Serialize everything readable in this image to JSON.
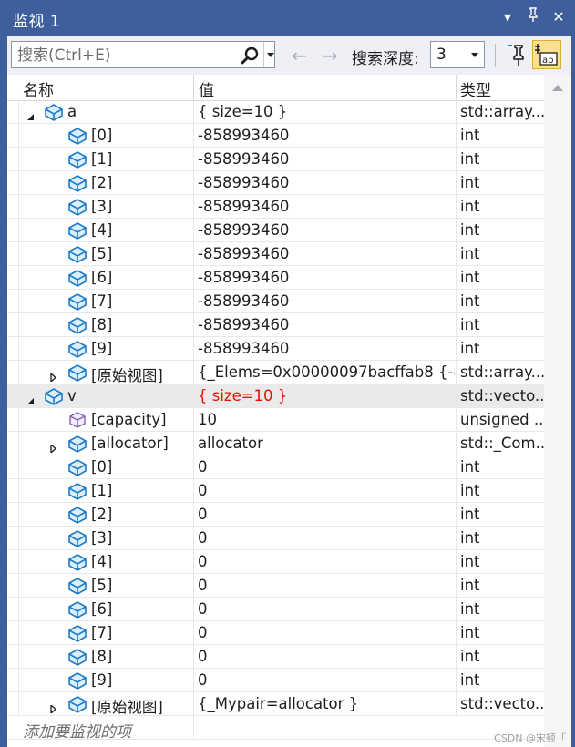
{
  "window": {
    "title": "监视 1"
  },
  "toolbar": {
    "search_placeholder": "搜索(Ctrl+E)",
    "depth_label": "搜索深度:",
    "depth_value": "3",
    "accent": "#3e5f9b"
  },
  "columns": {
    "name": "名称",
    "value": "值",
    "type": "类型"
  },
  "rows": [
    {
      "indent": 0,
      "expander": "expanded",
      "icon": "blue-cube-icon",
      "name": "a",
      "value": "{ size=10 }",
      "type": "std::array...",
      "changed": false,
      "selected": false
    },
    {
      "indent": 1,
      "expander": "none",
      "icon": "blue-cube-icon",
      "name": "[0]",
      "value": "-858993460",
      "type": "int",
      "changed": false,
      "selected": false
    },
    {
      "indent": 1,
      "expander": "none",
      "icon": "blue-cube-icon",
      "name": "[1]",
      "value": "-858993460",
      "type": "int",
      "changed": false,
      "selected": false
    },
    {
      "indent": 1,
      "expander": "none",
      "icon": "blue-cube-icon",
      "name": "[2]",
      "value": "-858993460",
      "type": "int",
      "changed": false,
      "selected": false
    },
    {
      "indent": 1,
      "expander": "none",
      "icon": "blue-cube-icon",
      "name": "[3]",
      "value": "-858993460",
      "type": "int",
      "changed": false,
      "selected": false
    },
    {
      "indent": 1,
      "expander": "none",
      "icon": "blue-cube-icon",
      "name": "[4]",
      "value": "-858993460",
      "type": "int",
      "changed": false,
      "selected": false
    },
    {
      "indent": 1,
      "expander": "none",
      "icon": "blue-cube-icon",
      "name": "[5]",
      "value": "-858993460",
      "type": "int",
      "changed": false,
      "selected": false
    },
    {
      "indent": 1,
      "expander": "none",
      "icon": "blue-cube-icon",
      "name": "[6]",
      "value": "-858993460",
      "type": "int",
      "changed": false,
      "selected": false
    },
    {
      "indent": 1,
      "expander": "none",
      "icon": "blue-cube-icon",
      "name": "[7]",
      "value": "-858993460",
      "type": "int",
      "changed": false,
      "selected": false
    },
    {
      "indent": 1,
      "expander": "none",
      "icon": "blue-cube-icon",
      "name": "[8]",
      "value": "-858993460",
      "type": "int",
      "changed": false,
      "selected": false
    },
    {
      "indent": 1,
      "expander": "none",
      "icon": "blue-cube-icon",
      "name": "[9]",
      "value": "-858993460",
      "type": "int",
      "changed": false,
      "selected": false
    },
    {
      "indent": 1,
      "expander": "collapsed",
      "icon": "blue-cube-icon",
      "name": "[原始视图]",
      "value": "{_Elems=0x00000097bacffab8 {-8...",
      "type": "std::array...",
      "changed": false,
      "selected": false
    },
    {
      "indent": 0,
      "expander": "expanded",
      "icon": "blue-cube-icon",
      "name": "v",
      "value": "{ size=10 }",
      "type": "std::vecto...",
      "changed": true,
      "selected": true
    },
    {
      "indent": 1,
      "expander": "none",
      "icon": "purple-cube-icon",
      "name": "[capacity]",
      "value": "10",
      "type": "unsigned ...",
      "changed": false,
      "selected": false
    },
    {
      "indent": 1,
      "expander": "collapsed",
      "icon": "blue-cube-icon",
      "name": "[allocator]",
      "value": "allocator",
      "type": "std::_Com...",
      "changed": false,
      "selected": false
    },
    {
      "indent": 1,
      "expander": "none",
      "icon": "blue-cube-icon",
      "name": "[0]",
      "value": "0",
      "type": "int",
      "changed": false,
      "selected": false
    },
    {
      "indent": 1,
      "expander": "none",
      "icon": "blue-cube-icon",
      "name": "[1]",
      "value": "0",
      "type": "int",
      "changed": false,
      "selected": false
    },
    {
      "indent": 1,
      "expander": "none",
      "icon": "blue-cube-icon",
      "name": "[2]",
      "value": "0",
      "type": "int",
      "changed": false,
      "selected": false
    },
    {
      "indent": 1,
      "expander": "none",
      "icon": "blue-cube-icon",
      "name": "[3]",
      "value": "0",
      "type": "int",
      "changed": false,
      "selected": false
    },
    {
      "indent": 1,
      "expander": "none",
      "icon": "blue-cube-icon",
      "name": "[4]",
      "value": "0",
      "type": "int",
      "changed": false,
      "selected": false
    },
    {
      "indent": 1,
      "expander": "none",
      "icon": "blue-cube-icon",
      "name": "[5]",
      "value": "0",
      "type": "int",
      "changed": false,
      "selected": false
    },
    {
      "indent": 1,
      "expander": "none",
      "icon": "blue-cube-icon",
      "name": "[6]",
      "value": "0",
      "type": "int",
      "changed": false,
      "selected": false
    },
    {
      "indent": 1,
      "expander": "none",
      "icon": "blue-cube-icon",
      "name": "[7]",
      "value": "0",
      "type": "int",
      "changed": false,
      "selected": false
    },
    {
      "indent": 1,
      "expander": "none",
      "icon": "blue-cube-icon",
      "name": "[8]",
      "value": "0",
      "type": "int",
      "changed": false,
      "selected": false
    },
    {
      "indent": 1,
      "expander": "none",
      "icon": "blue-cube-icon",
      "name": "[9]",
      "value": "0",
      "type": "int",
      "changed": false,
      "selected": false
    },
    {
      "indent": 1,
      "expander": "collapsed",
      "icon": "blue-cube-icon",
      "name": "[原始视图]",
      "value": "{_Mypair=allocator }",
      "type": "std::vecto...",
      "changed": false,
      "selected": false
    }
  ],
  "add_item_placeholder": "添加要监视的项",
  "watermark": "CSDN @宋顿「",
  "colors": {
    "changed_value": "#e51400",
    "selected_row": "#eaeaea",
    "icon_blue": "#1f7ac8",
    "icon_purple": "#8b5fb5"
  }
}
